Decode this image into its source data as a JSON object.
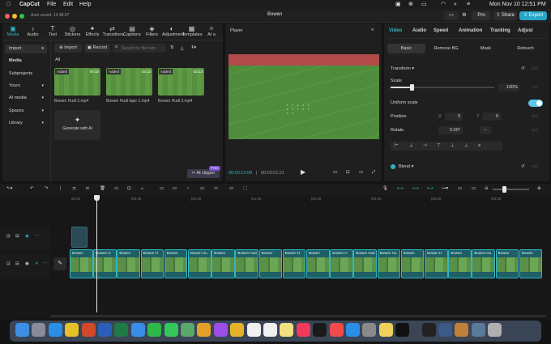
{
  "menubar": {
    "app": "CapCut",
    "items": [
      "File",
      "Edit",
      "Help"
    ],
    "datetime": "Mon Nov 10  12:51 PM"
  },
  "titlebar": {
    "autosave": "Auto saved: 12:48:07",
    "project_title": "Bowen",
    "pro_label": "Pro",
    "share_label": "Share",
    "export_label": "Export"
  },
  "media_tabs": [
    {
      "label": "Media",
      "icon": "media-icon"
    },
    {
      "label": "Audio",
      "icon": "audio-icon"
    },
    {
      "label": "Text",
      "icon": "text-icon"
    },
    {
      "label": "Stickers",
      "icon": "stickers-icon"
    },
    {
      "label": "Effects",
      "icon": "effects-icon"
    },
    {
      "label": "Transitions",
      "icon": "transitions-icon"
    },
    {
      "label": "Captions",
      "icon": "captions-icon"
    },
    {
      "label": "Filters",
      "icon": "filters-icon"
    },
    {
      "label": "Adjustment",
      "icon": "adjustment-icon"
    },
    {
      "label": "Templates",
      "icon": "templates-icon"
    },
    {
      "label": "AI a",
      "icon": "ai-icon"
    }
  ],
  "sidebar": {
    "items": [
      "Import",
      "Media",
      "Subprojects",
      "Yours",
      "AI media",
      "Spaces",
      "Library"
    ]
  },
  "media_toolbar": {
    "import_label": "Import",
    "record_label": "Record",
    "search_placeholder": "Search for file nam",
    "all_label": "All"
  },
  "media_items": [
    {
      "tag": "Added",
      "duration": "00:10",
      "name": "Bowen Hudl 2.mp4"
    },
    {
      "tag": "Added",
      "duration": "02:13",
      "name": "Bowen Hudl tape 1.mp4"
    },
    {
      "tag": "Added",
      "duration": "02:13",
      "name": "Bowen Hudl 3.mp4"
    }
  ],
  "generate": {
    "label": "Generate with AI"
  },
  "ai_clipper": {
    "label": "AI clipper",
    "badge": "Free"
  },
  "player": {
    "title": "Player",
    "current_time": "00:00:13:08",
    "total_time": "00:03:51:21"
  },
  "inspector": {
    "tabs": [
      "Video",
      "Audio",
      "Speed",
      "Animation",
      "Tracking",
      "Adjust"
    ],
    "subtabs": [
      "Basic",
      "Remove BG",
      "Mask",
      "Retouch"
    ],
    "transform_label": "Transform",
    "scale_label": "Scale",
    "scale_value": "100%",
    "scale_fraction": 0.2,
    "uniform_label": "Uniform scale",
    "position_label": "Position",
    "pos_x_label": "X",
    "pos_x": "0",
    "pos_y_label": "Y",
    "pos_y": "0",
    "rotate_label": "Rotate",
    "rotate_value": "0.00°",
    "blend_label": "Blend"
  },
  "timeline": {
    "ruler": [
      "00:00",
      "|00:30",
      "|01:00",
      "|01:30",
      "|02:00",
      "|02:30",
      "|03:00",
      "|03:30"
    ],
    "clip_labels": [
      "Bowen",
      "Bowen H",
      "Bowen",
      "Bowen H",
      "Bowen",
      "Bowen Hu",
      "Bowen",
      "Bowen Hud",
      "Bowen",
      "Bowen H",
      "Bowen",
      "Bowen H",
      "Bowen Hud",
      "Bowen Hu",
      "Bowen",
      "Bowen H",
      "Bowen",
      "Bowen Hu",
      "Bowen",
      "Bowen"
    ],
    "track_cover_label": "Cover"
  },
  "colors": {
    "accent": "#2fb5c4",
    "export": "#26a6c8",
    "toggle": "#5cc8e6"
  }
}
